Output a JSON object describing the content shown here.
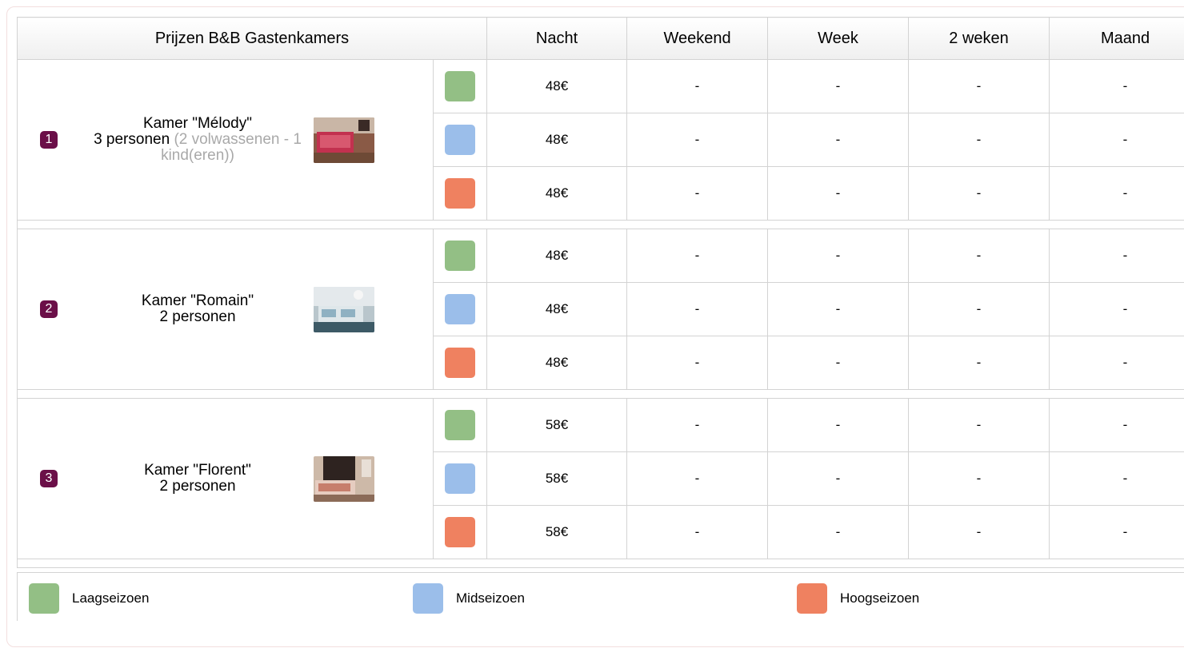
{
  "header": {
    "title": "Prijzen B&B Gastenkamers",
    "columns": [
      "Nacht",
      "Weekend",
      "Week",
      "2 weken",
      "Maand"
    ]
  },
  "colors": {
    "badge": "#6b0f48",
    "low_season": "#93bf85",
    "mid_season": "#9bbeea",
    "high_season": "#ef8160"
  },
  "rooms": [
    {
      "number": "1",
      "name": "Kamer \"Mélody\"",
      "persons": "3 personen",
      "extra": "(2 volwassenen - 1 kind(eren))",
      "photo": "bedroom-photo-red-bed",
      "rates": [
        {
          "season": "low",
          "values": [
            "48€",
            "-",
            "-",
            "-",
            "-"
          ]
        },
        {
          "season": "mid",
          "values": [
            "48€",
            "-",
            "-",
            "-",
            "-"
          ]
        },
        {
          "season": "high",
          "values": [
            "48€",
            "-",
            "-",
            "-",
            "-"
          ]
        }
      ]
    },
    {
      "number": "2",
      "name": "Kamer \"Romain\"",
      "persons": "2 personen",
      "extra": "",
      "photo": "bedroom-photo-light",
      "rates": [
        {
          "season": "low",
          "values": [
            "48€",
            "-",
            "-",
            "-",
            "-"
          ]
        },
        {
          "season": "mid",
          "values": [
            "48€",
            "-",
            "-",
            "-",
            "-"
          ]
        },
        {
          "season": "high",
          "values": [
            "48€",
            "-",
            "-",
            "-",
            "-"
          ]
        }
      ]
    },
    {
      "number": "3",
      "name": "Kamer \"Florent\"",
      "persons": "2 personen",
      "extra": "",
      "photo": "bedroom-photo-dark",
      "rates": [
        {
          "season": "low",
          "values": [
            "58€",
            "-",
            "-",
            "-",
            "-"
          ]
        },
        {
          "season": "mid",
          "values": [
            "58€",
            "-",
            "-",
            "-",
            "-"
          ]
        },
        {
          "season": "high",
          "values": [
            "58€",
            "-",
            "-",
            "-",
            "-"
          ]
        }
      ]
    }
  ],
  "legend": {
    "low": "Laagseizoen",
    "mid": "Midseizoen",
    "high": "Hoogseizoen"
  }
}
